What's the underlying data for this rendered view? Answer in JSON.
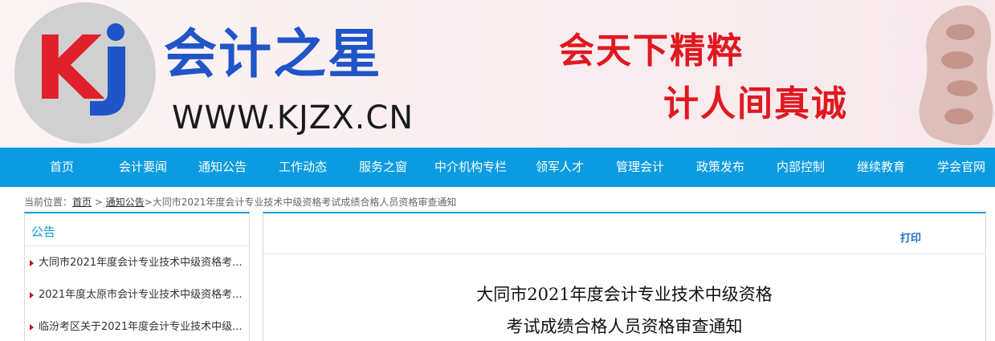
{
  "header": {
    "logo_icon": "kj-logo-icon",
    "logo_letter_k": "K",
    "site_name": "会计之星",
    "site_url": "WWW.KJZX.CN",
    "slogan_line1": "会天下精粹",
    "slogan_line2": "计人间真诚",
    "decoration_icon": "abacus-decoration-icon",
    "colors": {
      "logo_red": "#e0202a",
      "logo_blue": "#1f55c6",
      "slogan_red": "#e01820"
    }
  },
  "nav": {
    "color": "#0b9be0",
    "items": [
      {
        "label": "首页"
      },
      {
        "label": "会计要闻"
      },
      {
        "label": "通知公告"
      },
      {
        "label": "工作动态"
      },
      {
        "label": "服务之窗"
      },
      {
        "label": "中介机构专栏"
      },
      {
        "label": "领军人才"
      },
      {
        "label": "管理会计"
      },
      {
        "label": "政策发布"
      },
      {
        "label": "内部控制"
      },
      {
        "label": "继续教育"
      },
      {
        "label": "学会官网"
      }
    ]
  },
  "breadcrumb": {
    "prefix": "当前位置：",
    "home": "首页",
    "sep1": " > ",
    "section": "通知公告",
    "sep2": ">",
    "current": "大同市2021年度会计专业技术中级资格考试成绩合格人员资格审查通知"
  },
  "sidebar": {
    "title": "公告",
    "items": [
      {
        "label": "大同市2021年度会计专业技术中级资格考..."
      },
      {
        "label": "2021年度太原市会计专业技术中级资格考..."
      },
      {
        "label": "临汾考区关于2021年度会计专业技术中级..."
      }
    ]
  },
  "article": {
    "print_label": "打印",
    "title_line1": "大同市2021年度会计专业技术中级资格",
    "title_line2": "考试成绩合格人员资格审查通知"
  }
}
